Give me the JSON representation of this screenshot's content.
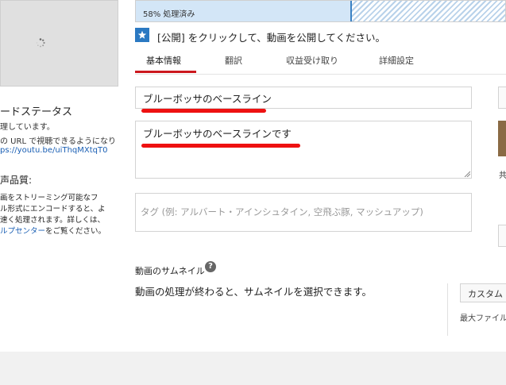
{
  "status": {
    "title": "ードステータス",
    "line1": "理しています。",
    "line2": "の URL で視聴できるようになり",
    "link": "ps://youtu.be/uiThqMXtqT0"
  },
  "quality": {
    "title": "声品質:",
    "line1": "画をストリーミング可能なフ",
    "line2": "ル形式にエンコードすると、よ",
    "line3": "速く処理されます。詳しくは、",
    "link": "ルプセンター",
    "line4_suffix": "をご覧ください。"
  },
  "progress": {
    "label": "58% 処理済み",
    "value": 58
  },
  "publish_note": "[公開] をクリックして、動画を公開してください。",
  "tabs": [
    {
      "label": "基本情報",
      "active": true
    },
    {
      "label": "翻訳",
      "active": false
    },
    {
      "label": "収益受け取り",
      "active": false
    },
    {
      "label": "詳細設定",
      "active": false
    }
  ],
  "form": {
    "title_value": "ブルーボッサのベースライン",
    "description_value": "ブルーボッサのベースラインです",
    "tags_placeholder": "タグ (例: アルバート・アインシュタイン, 空飛ぶ豚, マッシュアップ)"
  },
  "thumbnail": {
    "label": "動画のサムネイル",
    "help": "?",
    "message": "動画の処理が終わると、サムネイルを選択できます。",
    "custom_button": "カスタム サ",
    "max_file": "最大ファイル"
  },
  "right_edge": {
    "glyph": "共"
  },
  "colors": {
    "accent_red": "#cc181e",
    "annotation_red": "#ee1111",
    "link_blue": "#1a5fb4",
    "progress_fill": "#d3e6f7",
    "star_blue": "#2b79c2"
  }
}
